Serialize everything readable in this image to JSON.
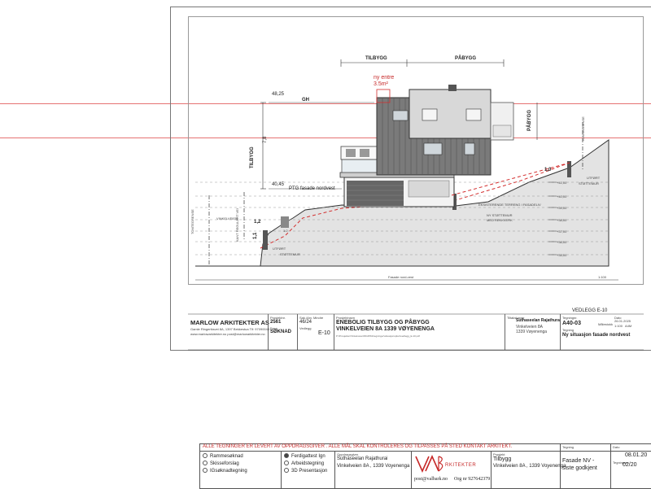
{
  "drawing": {
    "header_tilbygg": "TILBYGG",
    "header_pabygg": "PÅBYGG",
    "ny_entre_1": "ny entre",
    "ny_entre_2": "3.5m²",
    "gh_value": "48,25",
    "gh_label": "GH",
    "height_tilbygg": "7,8",
    "ptg_value": "40,45",
    "ptg_label": "PTG fasade nordvest",
    "vert_tilbygg": "TILBYGG",
    "vert_pabygg": "PÅBYGG",
    "tomtegrense_left": "TOMTEGRENSE",
    "tomtegrense_right": "TOMTEGRENSE",
    "kant_regulert_vei": "KANT REGULERT VEI",
    "vinkelveien": "VINKELVEIEN",
    "dim_12": "1,2",
    "dim_11": "1,1",
    "slope_12": "1:2",
    "utfort_stottemur_left_1": "UTFØRT",
    "utfort_stottemur_left_2": "STØTTEMUR",
    "exist_terreng": "EKSISTERENDE TERRENG I FASADELIV",
    "ny_stottemur_1": "NY STØTTEMUR",
    "ny_stottemur_2": "MED REKKVERK",
    "utfort_stottemur_right_1": "UTFØRT",
    "utfort_stottemur_right_2": "STØTTEMUR",
    "dim_10": "1,0",
    "levels": [
      "+41,00",
      "+40,00",
      "+39,00",
      "+38,00",
      "+37,00",
      "+36,00",
      "+35,00"
    ],
    "caption": "Fasade nord-vest",
    "scale": "1:100"
  },
  "title_block": {
    "vedlegg": "VEDLEGG  E-10",
    "company": "MARLOW ARKITEKTER AS",
    "company_addr": "Gamle Ringeriksvei 8A, 1397 Bekkestua   Tlf: 97090043",
    "company_web": "www.marlowarkitekter.no          post@marlowarkitekter.no",
    "prosjektnr_label": "Prosjektnr.",
    "prosjektnr": "2561",
    "fase_label": "Fase",
    "fase": "SØKNAD",
    "sak_label": "Sak./Arv. Mindre",
    "sak": "46/24",
    "vedlegg_label": "Vedlegg",
    "vedlegg_nr": "E-10",
    "prosjekt_label": "Prosjektnavn",
    "prosjekt_1": "ENEBOLIG  TILBYGG OG PÅBYGG",
    "prosjekt_2": "VINKELVEIEN 8A 1339 VØYENENGA",
    "path": "P:\\Prosjekter\\Vinkelveien\\8A\\2561\\tegninger\\situasjonsplan\\vedlegg_E-10.pdf",
    "tiltakshaver_label": "Tiltakshaver",
    "tiltakshaver": "Suthaseelan Rajathurai",
    "tiltak_addr_1": "Vinkelveien 8A",
    "tiltak_addr_2": "1339 Vøyenenga",
    "tegningnr_label": "Tegningnr.",
    "tegningnr": "A40-03",
    "dato_label": "Dato",
    "dato": "26.01.2025",
    "malestokk_label": "Målestokk",
    "malestokk": "1:100",
    "format": "A4M",
    "tegning_label": "Tegning",
    "tegning": "Ny situasjon fasade nordvest"
  },
  "lower_block": {
    "notice": "ALLE TEGNINGER ER LEVERT AV OPPDRAGSGIVER . ALLE MÅL SKAL KONTROLERES OG TILPASSES PÅ STED KONTAKT ARKITEKT.",
    "options_left": [
      "Rammesøknad",
      "Skisseforslag",
      "IGsøknadtegning"
    ],
    "options_mid": [
      "Ferdigattest Ign",
      "Arbeidstegning",
      "3D Presentasjon"
    ],
    "selected_option": "Ferdigattest Ign",
    "oppdragsgiver_label": "Oppdragsgiver",
    "oppdragsgiver": "Suthaseelan Rajathurai",
    "oppdragsgiver_addr": "Vinkelveien 8A , 1339 Voyenenga",
    "logo_text": "RKITEKTER",
    "post_email": "post@valbark.no",
    "org": "Org nr 927642379",
    "prosjekt_label": "Prosjekt",
    "prosjekt": "Tilbygg",
    "prosjekt_addr": "Vinkelveien 8A , 1339 Voyenenga",
    "tegning_label": "Tegning",
    "tegning_1": "Fasade NV  -",
    "tegning_2": "siste godkjent",
    "dato_label": "Dato",
    "dato": "08.01.20",
    "tegningnr_label": "Tegningsnr.",
    "tegningnr": "02/20"
  }
}
